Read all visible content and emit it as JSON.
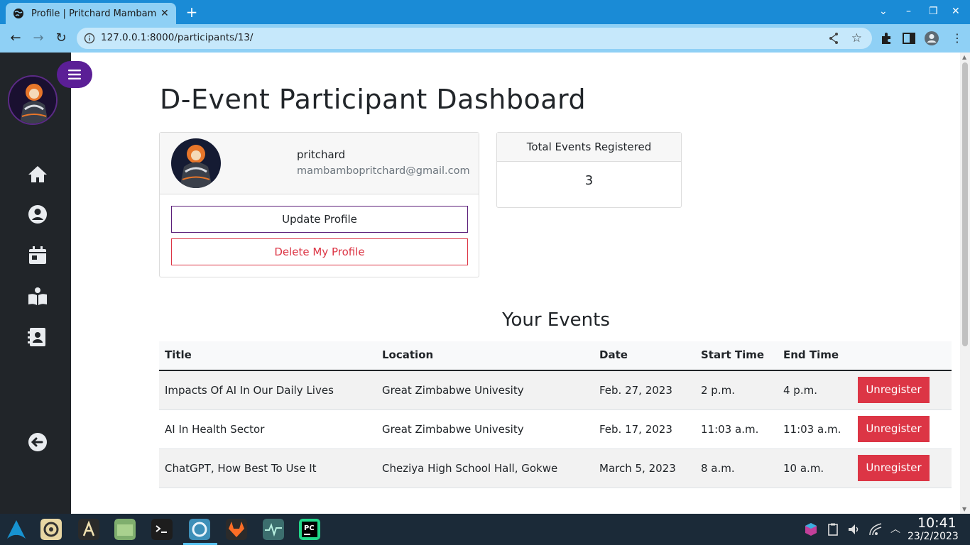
{
  "browser": {
    "tab_title": "Profile | Pritchard Mambambo",
    "url": "127.0.0.1:8000/participants/13/"
  },
  "page": {
    "title": "D-Event Participant Dashboard",
    "profile": {
      "username": "pritchard",
      "email": "mambambopritchard@gmail.com",
      "update_label": "Update Profile",
      "delete_label": "Delete My Profile"
    },
    "stats": {
      "label": "Total Events Registered",
      "value": "3"
    },
    "events_title": "Your Events",
    "table": {
      "headers": [
        "Title",
        "Location",
        "Date",
        "Start Time",
        "End Time"
      ],
      "rows": [
        {
          "title": "Impacts Of AI In Our Daily Lives",
          "location": "Great Zimbabwe Univesity",
          "date": "Feb. 27, 2023",
          "start": "2 p.m.",
          "end": "4 p.m.",
          "action": "Unregister"
        },
        {
          "title": "AI In Health Sector",
          "location": "Great Zimbabwe Univesity",
          "date": "Feb. 17, 2023",
          "start": "11:03 a.m.",
          "end": "11:03 a.m.",
          "action": "Unregister"
        },
        {
          "title": "ChatGPT, How Best To Use It",
          "location": "Cheziya High School Hall, Gokwe",
          "date": "March 5, 2023",
          "start": "8 a.m.",
          "end": "10 a.m.",
          "action": "Unregister"
        }
      ]
    }
  },
  "sidebar": {
    "icons": [
      "home-icon",
      "user-icon",
      "calendar-icon",
      "book-icon",
      "contacts-icon",
      "logout-icon"
    ]
  },
  "taskbar": {
    "time": "10:41",
    "date": "23/2/2023"
  },
  "colors": {
    "sidebar_bg": "#212529",
    "accent_purple": "#5b1f96",
    "danger": "#dc3545",
    "browser_blue": "#1a8bd6"
  }
}
